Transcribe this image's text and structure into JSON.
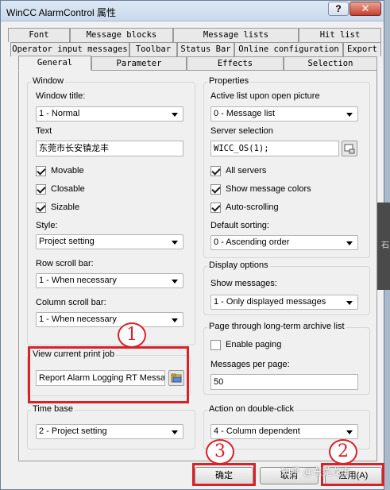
{
  "window": {
    "title": "WinCC AlarmControl 属性",
    "help_label": "?",
    "close_label": "✕"
  },
  "tabs": {
    "row1": [
      "Font",
      "Message blocks",
      "Message lists",
      "Hit list"
    ],
    "row2": [
      "Operator input messages",
      "Toolbar",
      "Status Bar",
      "Online configuration",
      "Export"
    ],
    "row3": [
      "General",
      "Parameter",
      "Effects",
      "Selection"
    ],
    "active": "General"
  },
  "window_group": {
    "legend": "Window",
    "window_title_label": "Window title:",
    "window_title_value": "1 - Normal",
    "text_label": "Text",
    "text_value": "东莞市长安镇龙丰",
    "movable_label": "Movable",
    "closable_label": "Closable",
    "sizable_label": "Sizable",
    "style_label": "Style:",
    "style_value": "Project setting",
    "row_scroll_label": "Row scroll bar:",
    "row_scroll_value": "1 - When necessary",
    "col_scroll_label": "Column scroll bar:",
    "col_scroll_value": "1 - When necessary"
  },
  "print_group": {
    "legend": "View current print job",
    "value": "Report Alarm Logging RT Message"
  },
  "timebase_group": {
    "legend": "Time base",
    "value": "2 - Project setting"
  },
  "properties_group": {
    "legend": "Properties",
    "open_list_label": "Active list upon open picture",
    "open_list_value": "0 - Message list",
    "server_label": "Server selection",
    "server_value": "WICC_OS(1);",
    "all_servers_label": "All servers",
    "show_colors_label": "Show message colors",
    "autoscroll_label": "Auto-scrolling",
    "default_sort_label": "Default sorting:",
    "default_sort_value": "0 - Ascending order"
  },
  "display_group": {
    "legend": "Display options",
    "show_messages_label": "Show messages:",
    "show_messages_value": "1 - Only displayed messages"
  },
  "archive_group": {
    "legend": "Page through long-term archive list",
    "enable_paging_label": "Enable paging",
    "per_page_label": "Messages per page:",
    "per_page_value": "50"
  },
  "dblclick_group": {
    "legend": "Action on double-click",
    "value": "4 - Column dependent"
  },
  "buttons": {
    "ok": "确定",
    "cancel": "取消",
    "apply": "应用(A)"
  },
  "annotations": {
    "mark1": "1",
    "mark2": "2",
    "mark3": "3"
  },
  "overlay": {
    "watermark": "知乎 @东莞龙丰",
    "side_text": "石"
  }
}
